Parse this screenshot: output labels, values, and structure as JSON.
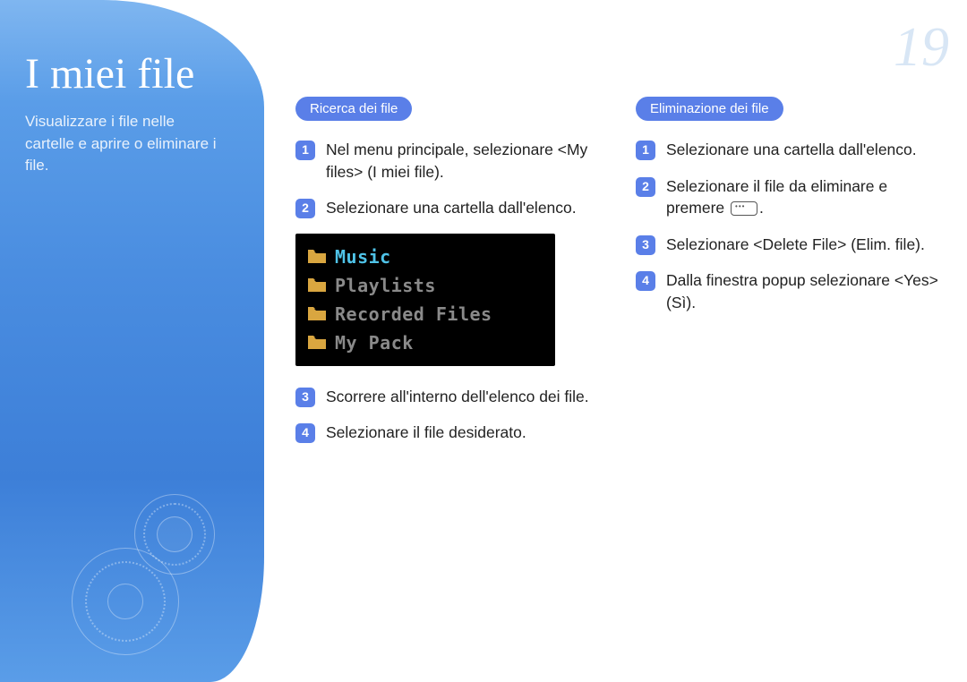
{
  "page_number": "19",
  "sidebar": {
    "title": "I miei file",
    "description": "Visualizzare i file nelle cartelle e aprire o eliminare i file."
  },
  "columns": {
    "search": {
      "heading": "Ricerca dei file",
      "steps": [
        "Nel menu principale, selezionare <My files> (I miei file).",
        "Selezionare una cartella dall'elenco.",
        "Scorrere all'interno dell'elenco dei file.",
        "Selezionare il file desiderato."
      ]
    },
    "delete": {
      "heading": "Eliminazione dei file",
      "steps": [
        "Selezionare una cartella dall'elenco.",
        "Selezionare il file da eliminare e premere ",
        "Selezionare <Delete File> (Elim. file).",
        "Dalla finestra popup selezionare <Yes> (Sì)."
      ],
      "step2_suffix": "."
    }
  },
  "device_screen": {
    "items": [
      {
        "label": "Music",
        "selected": true
      },
      {
        "label": "Playlists",
        "selected": false
      },
      {
        "label": "Recorded Files",
        "selected": false
      },
      {
        "label": "My Pack",
        "selected": false
      }
    ]
  },
  "colors": {
    "accent": "#5a7fe8",
    "device_selected": "#4fc3e8",
    "folder_icon": "#d9a640"
  }
}
